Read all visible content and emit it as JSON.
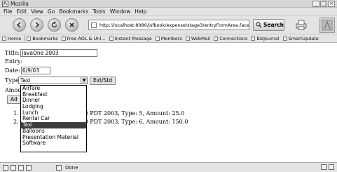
{
  "window": {
    "title": "Mozilla",
    "buttons": [
      "_",
      "□",
      "×"
    ]
  },
  "menu": [
    "File",
    "Edit",
    "View",
    "Go",
    "Bookmarks",
    "Tools",
    "Window",
    "Help"
  ],
  "nav": {
    "url": "http://localhost:8080/jsfbook/expense/stage3/entryFormArea.faces",
    "search_label": "Search",
    "icons": [
      "back-icon",
      "forward-icon",
      "reload-icon",
      "stop-icon",
      "print-icon"
    ]
  },
  "bookmarks": [
    "Home",
    "Bookmarks",
    "Free AOL & Unl...",
    "Instant Message",
    "Members",
    "WebMail",
    "Connections",
    "BizJournal",
    "SmartUpdate"
  ],
  "form": {
    "title_label": "Title:",
    "title_value": "JavaOne 2003",
    "entry_label": "Entry:",
    "date_label": "Date:",
    "date_value": "6/9/03",
    "type_label": "Type:",
    "type_value": "Taxi",
    "ext_button": "Ext/Std",
    "amount_label": "Amou",
    "add_button": "Ad"
  },
  "type_options": [
    "Airfare",
    "Breakfast",
    "Dinner",
    "Lodging",
    "Lunch",
    "Rental Car",
    "Taxi",
    "Balloons",
    "Presentation Material",
    "Software"
  ],
  "selected_option": "Taxi",
  "entries": [
    {
      "num": "1.",
      "text": "0 PDT 2003, Type: 5, Amount: 25.0"
    },
    {
      "num": "2.",
      "text": "0 PDT 2003, Type: 6, Amount: 150.0"
    }
  ],
  "status": {
    "text": "Done"
  }
}
